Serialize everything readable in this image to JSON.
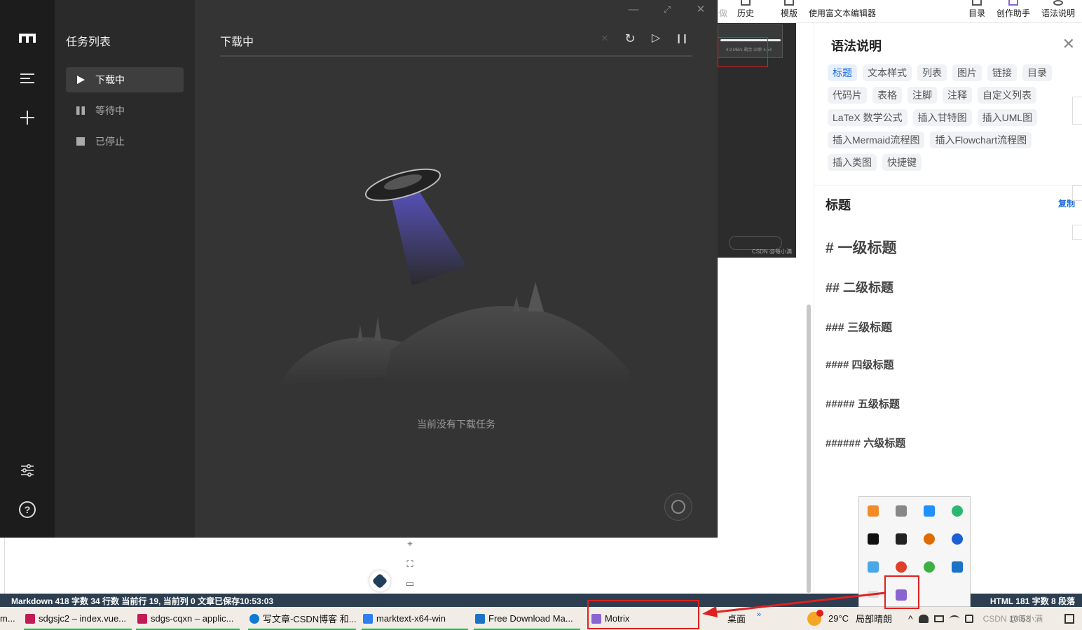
{
  "background_toolbar": {
    "items": [
      "做",
      "历史",
      "模版",
      "使用富文本编辑器",
      "目录",
      "创作助手",
      "语法说明"
    ]
  },
  "preview_image": {
    "watermark": "CSDN @每小满",
    "speed_text": "4.9 MB/s  剩余 20秒  4.54"
  },
  "syntax_panel": {
    "title": "语法说明",
    "close": "✕",
    "tags": [
      "标题",
      "文本样式",
      "列表",
      "图片",
      "链接",
      "目录",
      "代码片",
      "表格",
      "注脚",
      "注释",
      "自定义列表",
      "LaTeX 数学公式",
      "插入甘特图",
      "插入UML图",
      "插入Mermaid流程图",
      "插入Flowchart流程图",
      "插入类图",
      "快捷键"
    ],
    "section_title": "标题",
    "copy_label": "复制",
    "headings": [
      "# 一级标题",
      "## 二级标题",
      "### 三级标题",
      "#### 四级标题",
      "##### 五级标题",
      "###### 六级标题"
    ]
  },
  "status_bar": {
    "left": "Markdown  418 字数  34 行数  当前行 19, 当前列 0  文章已保存10:53:03",
    "right": "HTML  181 字数  8 段落"
  },
  "taskbar": {
    "items": [
      {
        "label": "m...",
        "color": "#3b3b3b"
      },
      {
        "label": "sdgsjc2 – index.vue...",
        "color": "#c21b55"
      },
      {
        "label": "sdgs-cqxn – applic...",
        "color": "#c21b55"
      },
      {
        "label": "写文章-CSDN博客 和...",
        "color": "#0f7ad6"
      },
      {
        "label": "marktext-x64-win",
        "color": "#2f7ff0"
      },
      {
        "label": "Free Download Ma...",
        "color": "#1a73c8"
      },
      {
        "label": "Motrix",
        "color": "#8a63d2"
      }
    ],
    "desktop_label": "桌面",
    "chevron": "»",
    "weather_temp": "29°C",
    "weather_desc": "局部晴朗",
    "clock": "10:53",
    "tray_overlay": "CSDN @每小满"
  },
  "motrix": {
    "sidebar_title": "任务列表",
    "nav": [
      {
        "label": "下载中",
        "active": true
      },
      {
        "label": "等待中",
        "active": false
      },
      {
        "label": "已停止",
        "active": false
      }
    ],
    "main_title": "下载中",
    "empty_text": "当前没有下载任务",
    "icons": {
      "clear": "✕",
      "refresh": "↻",
      "resume": "▷",
      "pause": "❙❙",
      "minimize": "—",
      "maximize": "⤢",
      "close": "✕",
      "help": "?"
    }
  },
  "editor_tools": {
    "locate": "⌖",
    "expand": "⛶",
    "monitor": "▭"
  },
  "colors": {
    "accent_red": "#e02020",
    "status_bar": "#2c3e50",
    "link_blue": "#1d6bdb",
    "motrix_bg": "#343434"
  }
}
